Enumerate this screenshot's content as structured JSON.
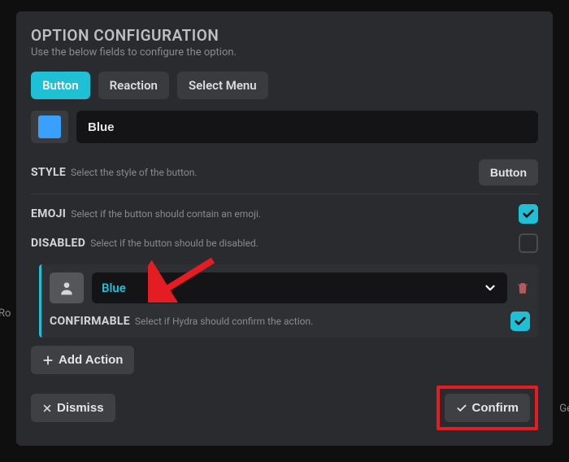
{
  "header": {
    "title": "OPTION CONFIGURATION",
    "subtitle": "Use the below fields to configure the option."
  },
  "tabs": {
    "button": "Button",
    "reaction": "Reaction",
    "select_menu": "Select Menu"
  },
  "color_swatch": "#3aa0ff",
  "label_input": {
    "value": "Blue"
  },
  "style_row": {
    "label": "STYLE",
    "hint": "Select the style of the button.",
    "button": "Button"
  },
  "emoji_row": {
    "label": "EMOJI",
    "hint": "Select if the button should contain an emoji.",
    "checked": true
  },
  "disabled_row": {
    "label": "DISABLED",
    "hint": "Select if the button should be disabled.",
    "checked": false
  },
  "dropdown": {
    "value": "Blue"
  },
  "confirmable_row": {
    "label": "CONFIRMABLE",
    "hint": "Select if Hydra should confirm the action.",
    "checked": true
  },
  "buttons": {
    "add_action": "Add Action",
    "dismiss": "Dismiss",
    "confirm": "Confirm"
  },
  "background_text": {
    "left": "Ro",
    "right": "Ge"
  }
}
